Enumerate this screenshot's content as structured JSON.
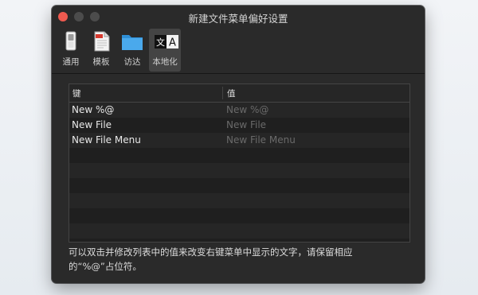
{
  "window": {
    "title": "新建文件菜单偏好设置"
  },
  "toolbar": {
    "items": [
      {
        "label": "通用",
        "icon": "switch-icon"
      },
      {
        "label": "模板",
        "icon": "file-template-icon"
      },
      {
        "label": "访达",
        "icon": "folder-icon"
      },
      {
        "label": "本地化",
        "icon": "localization-icon"
      }
    ],
    "selected": "本地化"
  },
  "table": {
    "headers": [
      "键",
      "值"
    ],
    "rows": [
      {
        "key": "New %@",
        "value": "New %@"
      },
      {
        "key": "New File",
        "value": "New File"
      },
      {
        "key": "New File Menu",
        "value": "New File Menu"
      }
    ]
  },
  "description": {
    "line1": "可以双击并修改列表中的值来改变右键菜单中显示的文字，请保留相应",
    "line2": "的“%@”占位符。"
  },
  "colors": {
    "window_bg": "#2a2a2a",
    "close_button": "#ef5a4f",
    "placeholder_text": "#6a6a6a"
  }
}
